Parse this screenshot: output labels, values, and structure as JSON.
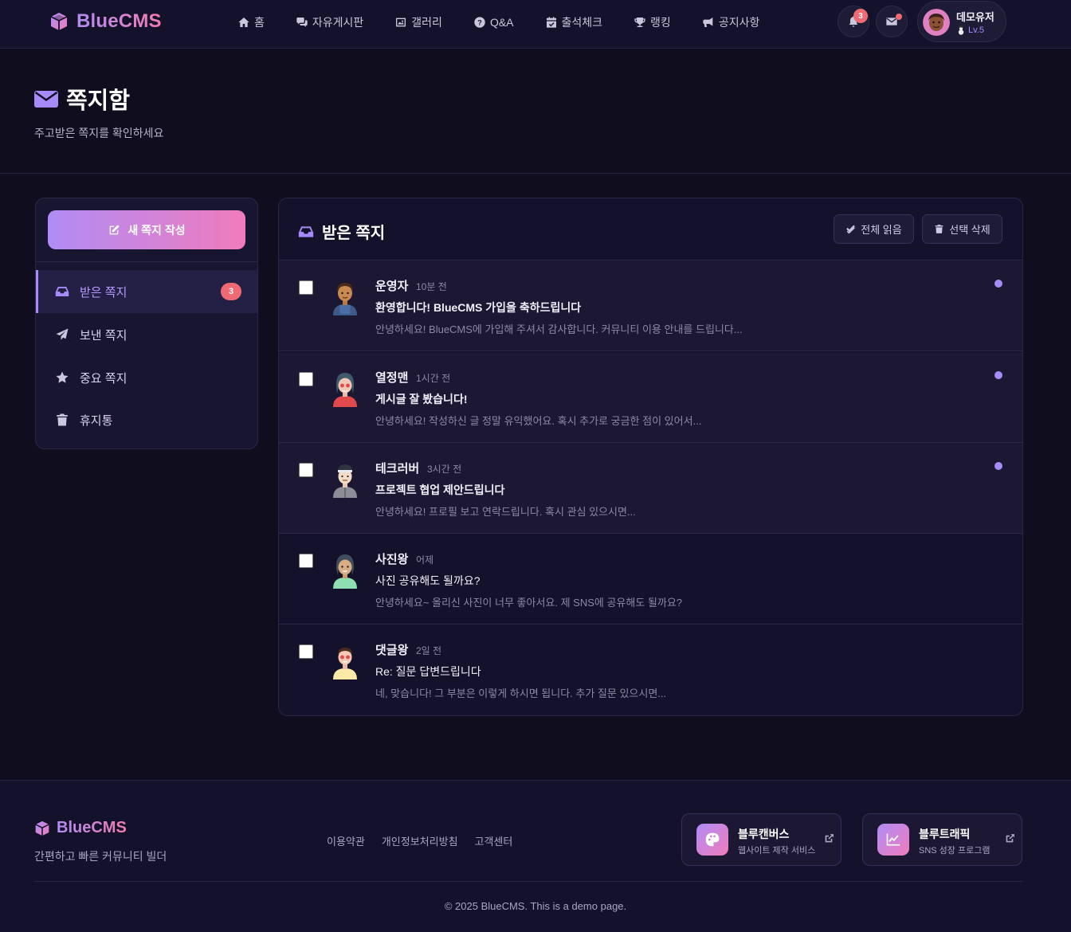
{
  "brand": {
    "name": "BlueCMS"
  },
  "nav": [
    {
      "label": "홈",
      "icon": "home-icon"
    },
    {
      "label": "자유게시판",
      "icon": "comments-icon"
    },
    {
      "label": "갤러리",
      "icon": "images-icon"
    },
    {
      "label": "Q&A",
      "icon": "question-circle-icon"
    },
    {
      "label": "출석체크",
      "icon": "calendar-check-icon"
    },
    {
      "label": "랭킹",
      "icon": "trophy-icon"
    },
    {
      "label": "공지사항",
      "icon": "bullhorn-icon"
    }
  ],
  "header": {
    "notification_count": "3",
    "user": {
      "name": "데모유저",
      "level": "Lv.5"
    }
  },
  "page": {
    "title": "쪽지함",
    "subtitle": "주고받은 쪽지를 확인하세요"
  },
  "sidebar": {
    "compose_label": "새 쪽지 작성",
    "items": [
      {
        "label": "받은 쪽지",
        "badge": "3",
        "icon": "inbox-icon",
        "active": true
      },
      {
        "label": "보낸 쪽지",
        "icon": "paper-plane-icon"
      },
      {
        "label": "중요 쪽지",
        "icon": "star-icon"
      },
      {
        "label": "휴지통",
        "icon": "trash-icon"
      }
    ]
  },
  "inbox": {
    "title": "받은 쪽지",
    "mark_all_read_label": "전체 읽음",
    "delete_selected_label": "선택 삭제",
    "messages": [
      {
        "sender": "운영자",
        "time": "10분 전",
        "subject": "환영합니다! BlueCMS 가입을 축하드립니다",
        "preview": "안녕하세요! BlueCMS에 가입해 주셔서 감사합니다. 커뮤니티 이용 안내를 드립니다...",
        "unread": true
      },
      {
        "sender": "열정맨",
        "time": "1시간 전",
        "subject": "게시글 잘 봤습니다!",
        "preview": "안녕하세요! 작성하신 글 정말 유익했어요. 혹시 추가로 궁금한 점이 있어서...",
        "unread": true
      },
      {
        "sender": "테크러버",
        "time": "3시간 전",
        "subject": "프로젝트 협업 제안드립니다",
        "preview": "안녕하세요! 프로필 보고 연락드립니다. 혹시 관심 있으시면...",
        "unread": true
      },
      {
        "sender": "사진왕",
        "time": "어제",
        "subject": "사진 공유해도 될까요?",
        "preview": "안녕하세요~ 올리신 사진이 너무 좋아서요. 제 SNS에 공유해도 될까요?",
        "unread": false
      },
      {
        "sender": "댓글왕",
        "time": "2일 전",
        "subject": "Re: 질문 답변드립니다",
        "preview": "네, 맞습니다! 그 부분은 이렇게 하시면 됩니다. 추가 질문 있으시면...",
        "unread": false
      }
    ]
  },
  "footer": {
    "brand": "BlueCMS",
    "tagline": "간편하고 빠른 커뮤니티 빌더",
    "links": [
      "이용약관",
      "개인정보처리방침",
      "고객센터"
    ],
    "promos": [
      {
        "title": "블루캔버스",
        "subtitle": "웹사이트 제작 서비스",
        "icon": "palette-icon"
      },
      {
        "title": "블루트래픽",
        "subtitle": "SNS 성장 프로그램",
        "icon": "chart-line-icon"
      }
    ],
    "copyright": "© 2025 BlueCMS. This is a demo page."
  },
  "colors": {
    "background": "#0f0d1e",
    "surface": "#14122a",
    "accent": "#a78bfa",
    "gradient_start": "#b08cf6",
    "gradient_end": "#f07cbc",
    "badge": "#ef6a73"
  }
}
